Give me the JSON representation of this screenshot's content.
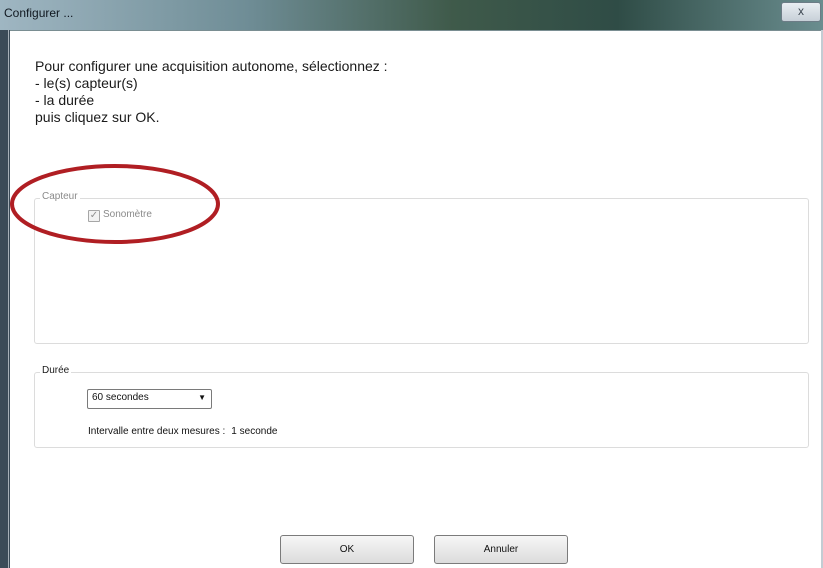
{
  "window": {
    "title": "Configurer ...",
    "close_label": "x"
  },
  "instructions": {
    "lines": [
      "Pour configurer une acquisition autonome, sélectionnez :",
      "- le(s) capteur(s)",
      "- la durée",
      "puis cliquez sur OK."
    ]
  },
  "capteur": {
    "group_label": "Capteur",
    "sensors": [
      {
        "label": "Sonomètre",
        "checked": true,
        "enabled": false
      }
    ]
  },
  "duree": {
    "group_label": "Durée",
    "selected": "60 secondes",
    "interval_label": "Intervalle entre deux mesures :",
    "interval_value": "1 seconde"
  },
  "buttons": {
    "ok_label": "OK",
    "cancel_label": "Annuler"
  },
  "colors": {
    "highlight": "#b01e23"
  }
}
